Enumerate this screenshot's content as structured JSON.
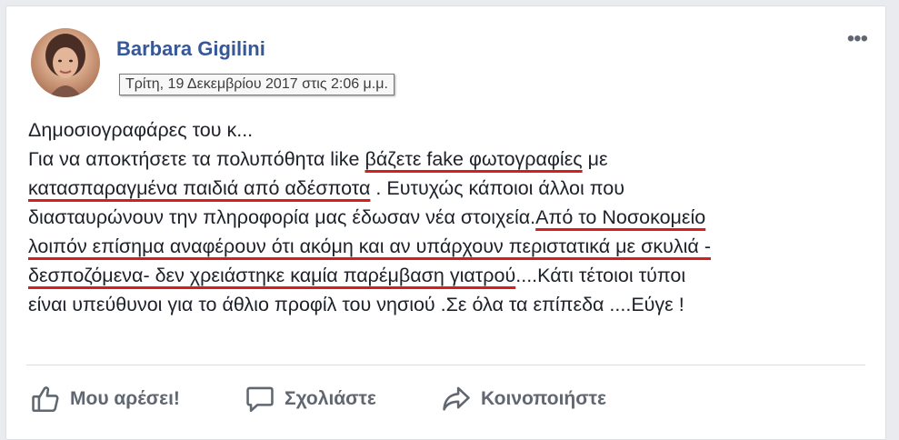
{
  "post": {
    "author": "Barbara Gigilini",
    "timestamp": "Τρίτη, 19 Δεκεμβρίου 2017 στις 2:06 μ.μ.",
    "more_glyph": "•••",
    "lines": [
      [
        {
          "t": "Δημοσιογραφάρες του κ...",
          "u": false
        }
      ],
      [
        {
          "t": "Για να αποκτήσετε τα πολυπόθητα like ",
          "u": false
        },
        {
          "t": "βάζετε fake φωτογραφίες",
          "u": true
        },
        {
          "t": " με",
          "u": false
        }
      ],
      [
        {
          "t": "κατασπαραγμένα παιδιά από αδέσποτα",
          "u": true
        },
        {
          "t": " . Ευτυχώς κάποιοι άλλοι που",
          "u": false
        }
      ],
      [
        {
          "t": "διασταυρώνουν την πληροφορία μας έδωσαν νέα στοιχεία.",
          "u": false
        },
        {
          "t": "Από το Νοσοκομείο",
          "u": true
        }
      ],
      [
        {
          "t": "λοιπόν επίσημα αναφέρουν ότι ακόμη και αν υπάρχουν περιστατικά με σκυλιά -",
          "u": true
        }
      ],
      [
        {
          "t": "δεσποζόμενα- δεν χρειάστηκε καμία παρέμβαση γιατρού",
          "u": true
        },
        {
          "t": "....Κάτι τέτοιοι τύποι",
          "u": false
        }
      ],
      [
        {
          "t": "είναι υπεύθυνοι για το άθλιο προφίλ του νησιού .Σε όλα τα επίπεδα ....Εύγε !",
          "u": false
        }
      ]
    ]
  },
  "actions": {
    "like": {
      "label": "Μου αρέσει!",
      "icon": "thumbs-up-icon"
    },
    "comment": {
      "label": "Σχολιάστε",
      "icon": "comment-icon"
    },
    "share": {
      "label": "Κοινοποιήστε",
      "icon": "share-icon"
    }
  },
  "colors": {
    "author": "#365899",
    "underline": "#d4201d",
    "action_text": "#606770",
    "background": "#e9ebee"
  }
}
